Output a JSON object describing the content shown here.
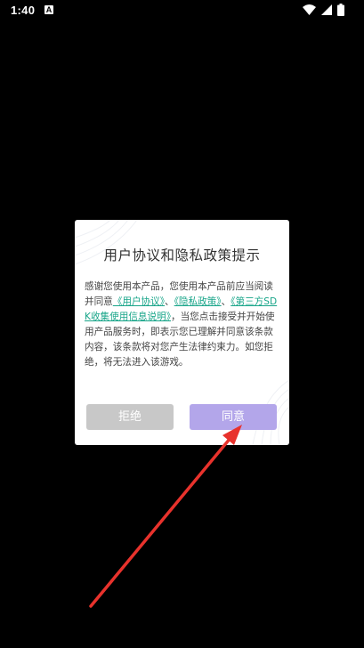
{
  "status_bar": {
    "time": "1:40",
    "notification_icon": "a-letter-icon",
    "icons": [
      "wifi-icon",
      "signal-icon",
      "battery-icon"
    ]
  },
  "dialog": {
    "title": "用户协议和隐私政策提示",
    "body": {
      "intro": "感谢您使用本产品，您使用本产品前应当阅读并同意",
      "link_user_agreement": "《用户协议》",
      "sep1": "、",
      "link_privacy_policy": "《隐私政策》",
      "sep2": "、",
      "link_sdk": "《第三方SDK收集使用信息说明》",
      "rest": "，当您点击接受并开始使用产品服务时，即表示您已理解并同意该条款内容，该条款将对您产生法律约束力。如您拒绝，将无法进入该游戏。"
    },
    "reject_label": "拒绝",
    "agree_label": "同意"
  },
  "colors": {
    "background": "#000000",
    "link": "#18a589",
    "reject_button": "#c8c8c8",
    "agree_button": "#b3a6ea",
    "annotation_arrow": "#e8322c"
  },
  "annotation": {
    "type": "red-arrow",
    "points_to": "agree-button"
  }
}
